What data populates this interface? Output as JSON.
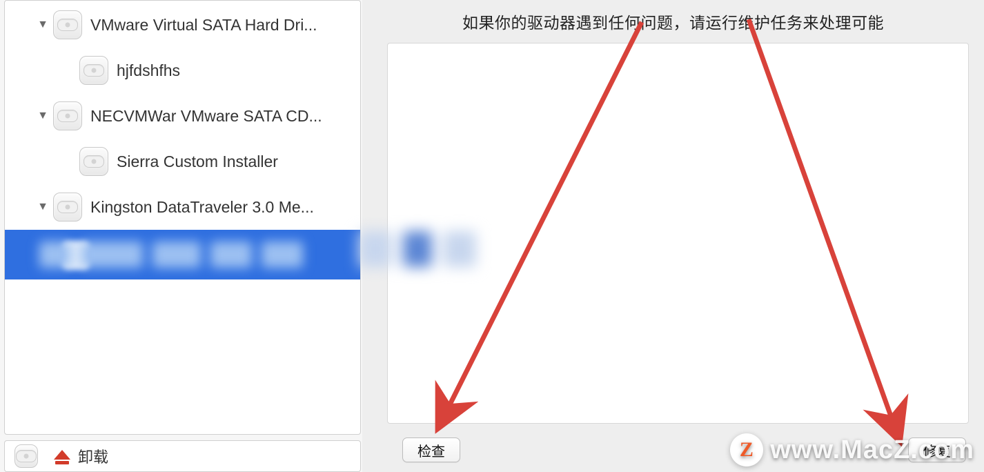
{
  "sidebar": {
    "items": [
      {
        "label": "VMware Virtual SATA Hard Dri...",
        "expandable": true
      },
      {
        "label": "hjfdshfhs",
        "expandable": false
      },
      {
        "label": "NECVMWar VMware SATA CD...",
        "expandable": true
      },
      {
        "label": "Sierra Custom Installer",
        "expandable": false
      },
      {
        "label": "Kingston DataTraveler 3.0 Me...",
        "expandable": true
      }
    ]
  },
  "bottom_bar": {
    "unmount_label": "卸载"
  },
  "main": {
    "instruction": "如果你的驱动器遇到任何问题，请运行维护任务来处理可能",
    "buttons": {
      "check": "检查",
      "repair": "修复"
    }
  },
  "annotations": {
    "arrow_color": "#d8423a"
  },
  "watermark": {
    "badge": "Z",
    "text": "www.MacZ.com"
  }
}
